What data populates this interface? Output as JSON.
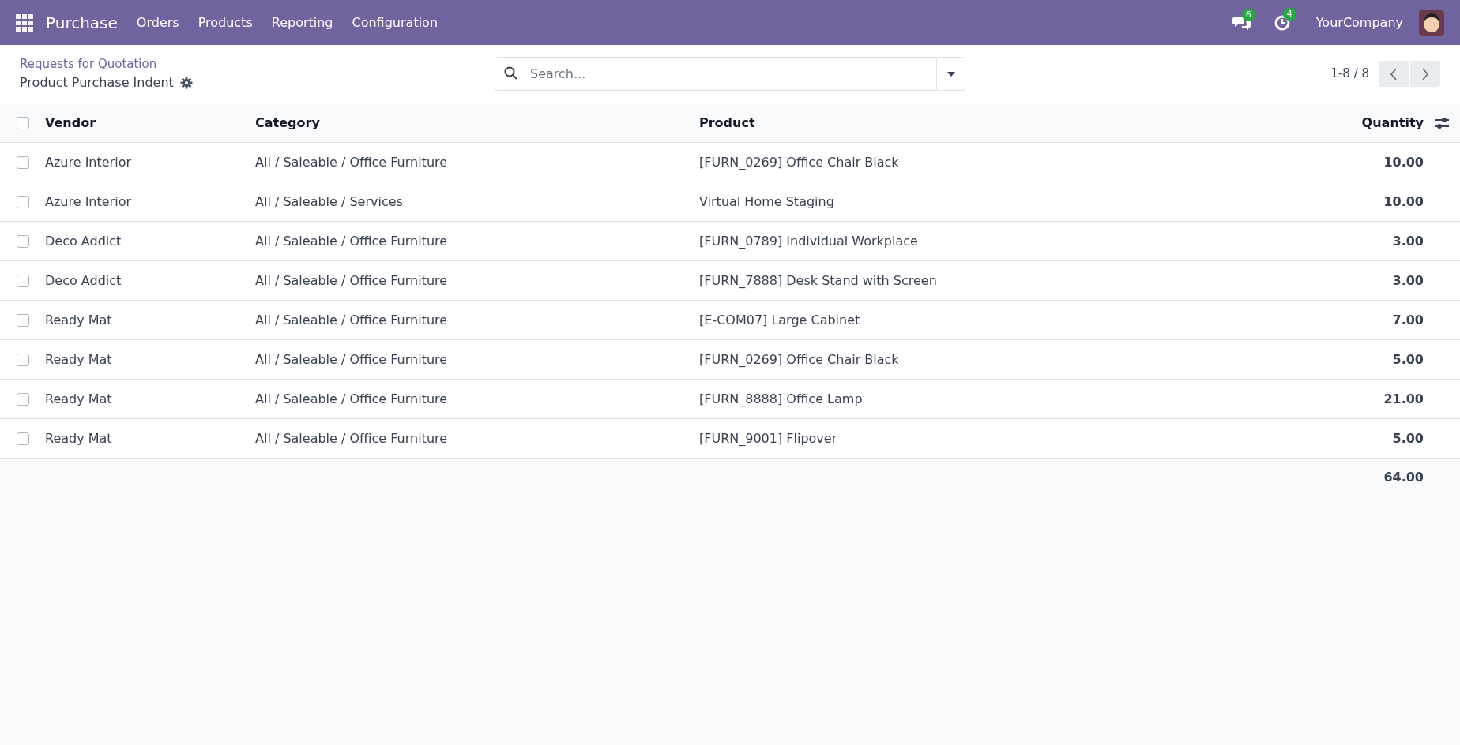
{
  "navbar": {
    "app": "Purchase",
    "menu": [
      "Orders",
      "Products",
      "Reporting",
      "Configuration"
    ],
    "messages_count": "6",
    "activities_count": "4",
    "company": "YourCompany"
  },
  "control_panel": {
    "breadcrumb": "Requests for Quotation",
    "title": "Product Purchase Indent",
    "search": {
      "placeholder": "Search..."
    },
    "pager": "1-8 / 8"
  },
  "table": {
    "all_checked": false,
    "columns": [
      "Vendor",
      "Category",
      "Product",
      "Quantity"
    ],
    "rows": [
      {
        "checked": false,
        "vendor": "Azure Interior",
        "category": "All / Saleable / Office Furniture",
        "product": "[FURN_0269] Office Chair Black",
        "quantity": "10.00"
      },
      {
        "checked": false,
        "vendor": "Azure Interior",
        "category": "All / Saleable / Services",
        "product": "Virtual Home Staging",
        "quantity": "10.00"
      },
      {
        "checked": false,
        "vendor": "Deco Addict",
        "category": "All / Saleable / Office Furniture",
        "product": "[FURN_0789] Individual Workplace",
        "quantity": "3.00"
      },
      {
        "checked": false,
        "vendor": "Deco Addict",
        "category": "All / Saleable / Office Furniture",
        "product": "[FURN_7888] Desk Stand with Screen",
        "quantity": "3.00"
      },
      {
        "checked": false,
        "vendor": "Ready Mat",
        "category": "All / Saleable / Office Furniture",
        "product": "[E-COM07] Large Cabinet",
        "quantity": "7.00"
      },
      {
        "checked": false,
        "vendor": "Ready Mat",
        "category": "All / Saleable / Office Furniture",
        "product": "[FURN_0269] Office Chair Black",
        "quantity": "5.00"
      },
      {
        "checked": false,
        "vendor": "Ready Mat",
        "category": "All / Saleable / Office Furniture",
        "product": "[FURN_8888] Office Lamp",
        "quantity": "21.00"
      },
      {
        "checked": false,
        "vendor": "Ready Mat",
        "category": "All / Saleable / Office Furniture",
        "product": "[FURN_9001] Flipover",
        "quantity": "5.00"
      }
    ],
    "total_quantity": "64.00"
  }
}
